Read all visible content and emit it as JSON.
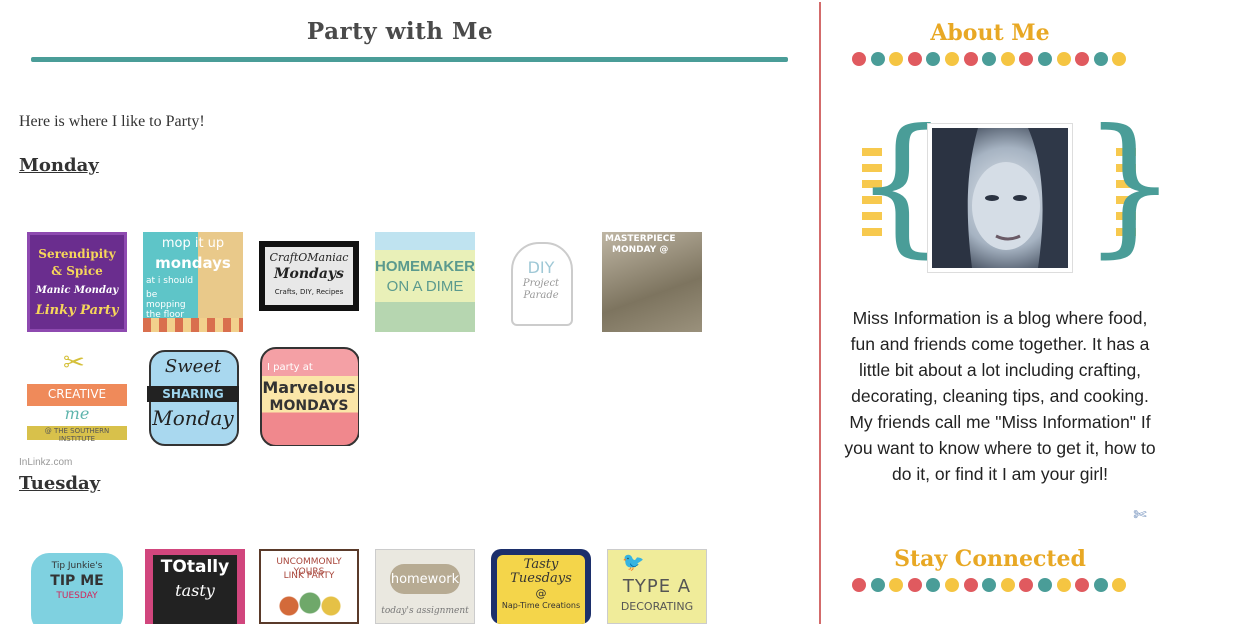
{
  "post": {
    "title": "Party with Me",
    "intro": "Here is where I like to Party!",
    "monday_label": "Monday",
    "tuesday_label": "Tuesday",
    "inlinkz_label": "InLinkz.com"
  },
  "monday_badges": [
    {
      "l1": "Serendipity",
      "l2": "& Spice",
      "l3": "Manic Monday",
      "l4": "Linky Party"
    },
    {
      "l1": "mop it up",
      "l2": "mondays",
      "l3": "at i should",
      "l4": "be mopping the floor"
    },
    {
      "l1": "CraftOManiac",
      "l2": "Mondays",
      "l3": "Crafts, DIY, Recipes"
    },
    {
      "l1": "HOMEMAKER",
      "l2": "ON A DIME"
    },
    {
      "l1": "DIY",
      "l2": "Project",
      "l3": "Parade"
    },
    {
      "l1": "MASTERPIECE",
      "l2": "MONDAY @"
    },
    {
      "l1": "CREATIVE",
      "l2": "me",
      "l3": "@ THE SOUTHERN INSTITUTE"
    },
    {
      "l1": "Sweet",
      "l2": "SHARING",
      "l3": "Monday"
    },
    {
      "l1": "I party at",
      "l2": "Marvelous",
      "l3": "MONDAYS"
    }
  ],
  "tuesday_badges": [
    {
      "l1": "Tip Junkie's",
      "l2": "TIP ME",
      "l3": "TUESDAY"
    },
    {
      "l1": "TOtally",
      "l2": "tasty"
    },
    {
      "l1": "UNCOMMONLY YOURS",
      "l2": "LINK PARTY"
    },
    {
      "l1": "homework",
      "l2": "today's assignment"
    },
    {
      "l1": "Tasty",
      "l2": "Tuesdays",
      "l3": "@",
      "l4": "Nap-Time Creations"
    },
    {
      "l1": "TYPE A",
      "l2": "DECORATING"
    }
  ],
  "sidebar": {
    "about_title": "About Me",
    "about_text": "Miss Information is a blog where food, fun and friends come together. It has a little bit about a lot including crafting, decorating, cleaning tips, and cooking. My friends call me \"Miss Information\" If you want to know where to get it, how to do it, or find it I am your girl!",
    "stay_title": "Stay Connected"
  },
  "colors": {
    "accent_teal": "#4a9d98",
    "accent_gold": "#e8a824",
    "dot_red": "#e05a5f",
    "dot_teal": "#4a9d98",
    "dot_yellow": "#f5c542",
    "divider": "#d36b6b"
  }
}
